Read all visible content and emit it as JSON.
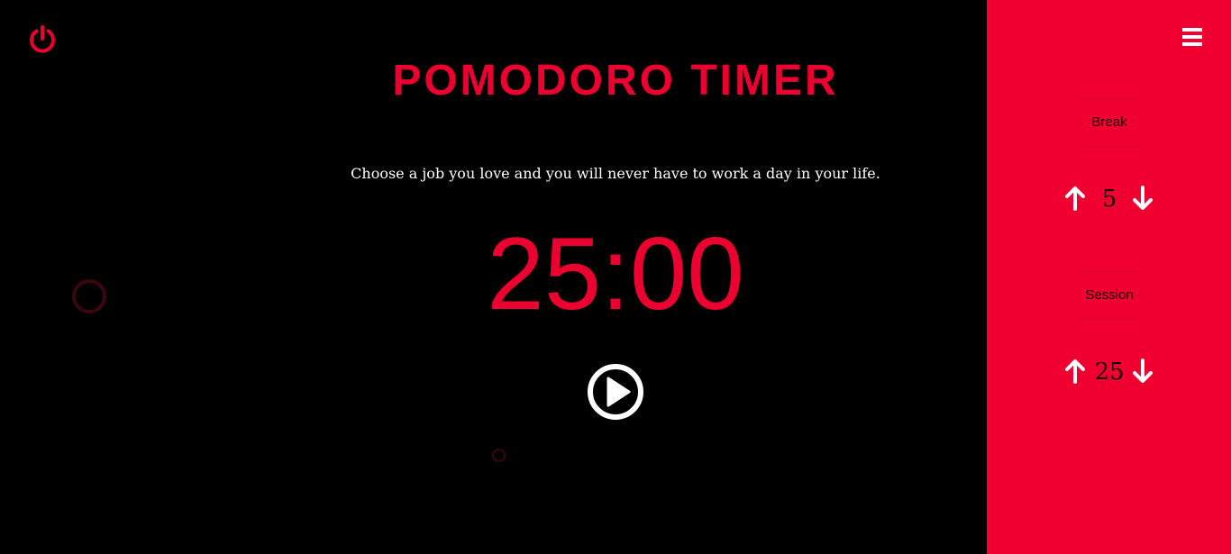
{
  "header": {
    "title": "POMODORO TIMER",
    "quote": "Choose a job you love and you will never have to work a day in your life."
  },
  "timer": {
    "display": "25:00"
  },
  "icons": {
    "power": "power-icon",
    "play": "play-circle-icon",
    "menu": "hamburger-menu-icon",
    "up": "arrow-up-icon",
    "down": "arrow-down-icon"
  },
  "settings": {
    "break": {
      "label": "Break",
      "value": "5"
    },
    "session": {
      "label": "Session",
      "value": "25"
    }
  },
  "colors": {
    "accent": "#ec0030",
    "sidebar": "#f00030",
    "background": "#000000",
    "text_light": "#ffffff",
    "text_dark": "#1a0005"
  }
}
